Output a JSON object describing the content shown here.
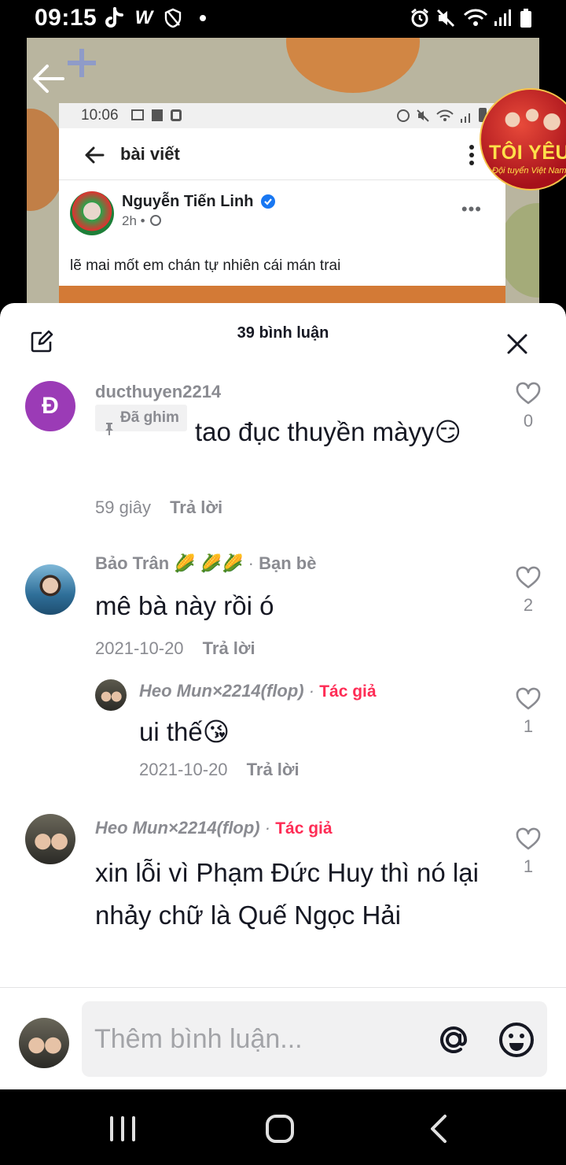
{
  "status_bar": {
    "time": "09:15",
    "icons": [
      "tiktok-icon",
      "w-app-icon",
      "shield-icon",
      "alarm-icon",
      "mute-icon",
      "wifi-icon",
      "signal-icon",
      "battery-icon"
    ]
  },
  "embedded_post": {
    "status_time": "10:06",
    "header_title": "bài viết",
    "author": "Nguyễn Tiến Linh",
    "time": "2h •",
    "text": "lẽ mai mốt em chán tự nhiên cái mán trai"
  },
  "channel_badge": {
    "big": "TÔI YÊU",
    "small": "Đội tuyển Việt Nam"
  },
  "sheet": {
    "title": "39 bình luận"
  },
  "comments": [
    {
      "avatar_letter": "Đ",
      "username": "ducthuyen2214",
      "pinned_label": "Đã ghim",
      "text": "tao đục thuyền màyy😏",
      "time": "59 giây",
      "reply": "Trả lời",
      "likes": "0"
    },
    {
      "username": "Bảo Trân 🌽 🌽🌽",
      "relation": "Bạn bè",
      "text": "mê bà này rồi ó",
      "time": "2021-10-20",
      "reply": "Trả lời",
      "likes": "2"
    },
    {
      "username": "Heo Mun×2214(flop)",
      "relation": "Tác giả",
      "text": "ui thế😘",
      "time": "2021-10-20",
      "reply": "Trả lời",
      "likes": "1"
    },
    {
      "username": "Heo Mun×2214(flop)",
      "relation": "Tác giả",
      "text": "xin lỗi vì Phạm Đức Huy thì nó lại nhảy chữ là Quế Ngọc Hải",
      "likes": "1"
    }
  ],
  "input": {
    "placeholder": "Thêm bình luận..."
  },
  "colors": {
    "accent": "#fe2c55",
    "muted_text": "#8a8b91",
    "primary_text": "#161823",
    "input_bg": "#f1f1f2",
    "avatar_purple": "#9b3bb6"
  }
}
